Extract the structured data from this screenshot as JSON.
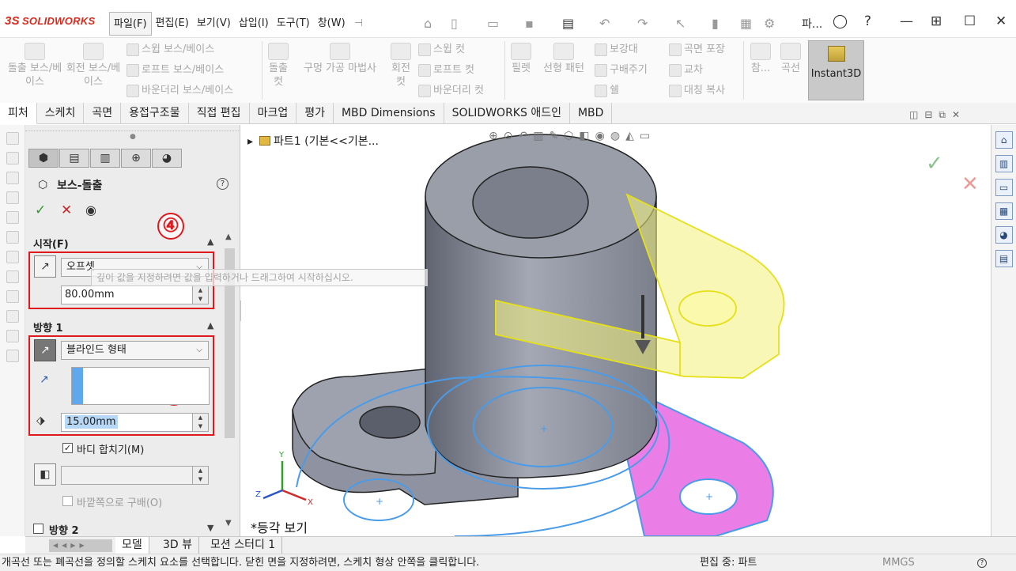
{
  "app": {
    "logo_text": "SOLIDWORKS",
    "logo_mark": "3S"
  },
  "menu": [
    {
      "label": "파일(F)",
      "active": true
    },
    {
      "label": "편집(E)"
    },
    {
      "label": "보기(V)"
    },
    {
      "label": "삽입(I)"
    },
    {
      "label": "도구(T)"
    },
    {
      "label": "창(W)"
    }
  ],
  "titlebar_right": {
    "truncated_label": "파..."
  },
  "ribbon": {
    "extrude_boss": "돌출 보스/베이스",
    "revolve_boss": "회전 보스/베이스",
    "sweep_boss": "스윕 보스/베이스",
    "loft_boss": "로프트 보스/베이스",
    "boundary_boss": "바운더리 보스/베이스",
    "extrude_cut": "돌출 컷",
    "hole_wizard": "구멍 가공 마법사",
    "revolve_cut": "회전 컷",
    "sweep_cut": "스윕 컷",
    "loft_cut": "로프트 컷",
    "boundary_cut": "바운더리 컷",
    "fillet": "필렛",
    "linear_pattern": "선형 패턴",
    "rib": "보강대",
    "draft": "구배주기",
    "shell": "쉘",
    "wrap": "곡면 포장",
    "intersect": "교차",
    "mirror": "대칭 복사",
    "reference": "참...",
    "curves": "곡선",
    "instant3d": "Instant3D"
  },
  "tabs": [
    "피처",
    "스케치",
    "곡면",
    "용접구조물",
    "직접 편집",
    "마크업",
    "평가",
    "MBD Dimensions",
    "SOLIDWORKS 애드인",
    "MBD"
  ],
  "property_manager": {
    "title": "보스-돌출",
    "help": "?",
    "from_section": "시작(F)",
    "from_type": "오프셋",
    "from_offset": "80.00mm",
    "dir1_section": "방향 1",
    "dir1_type": "블라인드 형태",
    "depth": "15.00mm",
    "merge_result": "바디 합치기(M)",
    "draft_outward": "바깥쪽으로 구배(O)",
    "dir2_section": "방향 2",
    "callout_4": "④",
    "callout_5": "⑤",
    "tooltip": "깊이 값을 지정하려면 값을 입력하거나 드래그하여 시작하십시오."
  },
  "graphics": {
    "feature_path": "파트1  (기본<<기본...",
    "view_name": "*등각 보기",
    "colors": {
      "body": "#8f93a1",
      "preview": "#f3f07a",
      "face": "#ea7de6",
      "sketch": "#4a9be8"
    }
  },
  "bottom_tabs": [
    "모델",
    "3D 뷰",
    "모션 스터디 1"
  ],
  "status": {
    "message": "개곡선 또는 폐곡선을 정의할 스케치 요소를 선택합니다. 닫힌 면을 지정하려면, 스케치 형상 안쪽을 클릭합니다.",
    "editing": "편집 중: 파트",
    "units": "MMGS"
  }
}
